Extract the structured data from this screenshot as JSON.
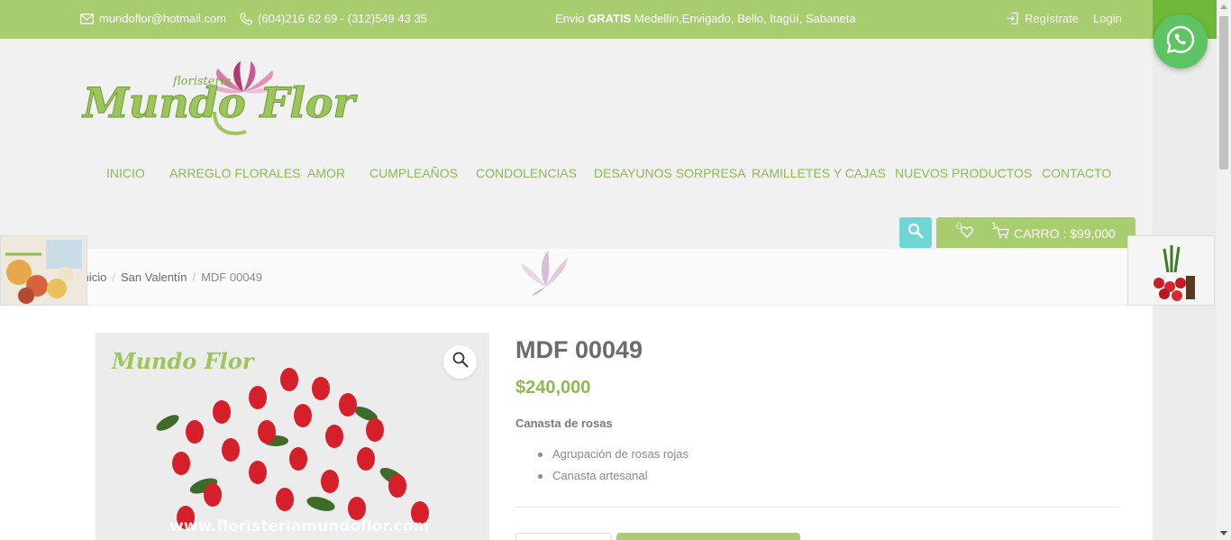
{
  "topbar": {
    "email": "mundoflor@hotmail.com",
    "phone": "(604)216 62 69 - (312)549 43 35",
    "shipping_prefix": "Envio ",
    "shipping_bold": "GRATIS",
    "shipping_rest": " Medellín,Envigado, Bello, Itagüí, Sabaneta",
    "register": "Regístrate",
    "login": "Login"
  },
  "logo": {
    "small": "floristeria",
    "main": "Mundo Flor"
  },
  "nav": {
    "items": [
      {
        "label": "INICIO"
      },
      {
        "label": "ARREGLO FLORALES"
      },
      {
        "label": "AMOR"
      },
      {
        "label": "CUMPLEAÑOS"
      },
      {
        "label": "CONDOLENCIAS"
      },
      {
        "label": "DESAYUNOS SORPRESA"
      },
      {
        "label": "RAMILLETES Y CAJAS"
      },
      {
        "label": "NUEVOS PRODUCTOS"
      },
      {
        "label": "CONTACTO"
      }
    ]
  },
  "cart": {
    "wishlist_count": "0",
    "item_count": "1",
    "label": "CARRO : $99,000"
  },
  "breadcrumb": {
    "home": "Inicio",
    "category": "San Valentín",
    "current": "MDF 00049"
  },
  "product": {
    "title": "MDF 00049",
    "price": "$240,000",
    "short_description": "Canasta de rosas",
    "features": [
      "Agrupación de rosas rojas",
      "Canasta artesanal"
    ],
    "image_watermark": "www.floristeriamundoflor.com"
  },
  "colors": {
    "brand_green": "#a8cd6f",
    "nav_green": "#8dbb52",
    "search_teal": "#6fd6d3",
    "whatsapp_green": "#5ec463"
  },
  "icons": [
    "envelope-icon",
    "phone-icon",
    "login-icon",
    "search-icon",
    "heart-icon",
    "cart-icon",
    "whatsapp-icon",
    "zoom-icon"
  ]
}
